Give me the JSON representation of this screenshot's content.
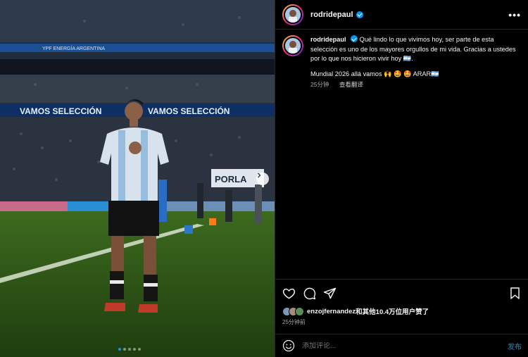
{
  "post": {
    "username": "rodridepaul",
    "more_label": "•••",
    "caption_line1": "Qué lindo lo que vivimos hoy, ser parte de esta selección es uno de los mayores orgullos de mi vida. Gracias a ustedes por lo que nos hicieron vivir hoy 🇦🇷.",
    "caption_line2": "Mundial 2026 allá vamos 🙌 🤩 🤩 ARAR🇦🇷",
    "caption_time": "25分钟",
    "see_translation": "查看翻译",
    "liked_by_user": "enzojfernandez",
    "liked_by_rest": "和其他10.4万位用户赞了",
    "time_ago": "25分钟前",
    "comment_placeholder": "添加评论...",
    "post_button": "发布"
  },
  "photo": {
    "banner_upper": "YPF ENERGÍA ARGENTINA",
    "banner_lower": "VAMOS SELECCIÓN",
    "sign_text": "PORLA",
    "carousel_dots": 5,
    "active_dot": 0
  },
  "icons": {
    "like": "heart-icon",
    "comment": "comment-icon",
    "share": "send-icon",
    "save": "bookmark-icon",
    "emoji": "emoji-icon",
    "next": "chevron-right-icon"
  },
  "colors": {
    "background": "#000000",
    "verified": "#0095f6",
    "post_button": "#2b5f86",
    "muted_text": "#a8a8a8"
  }
}
